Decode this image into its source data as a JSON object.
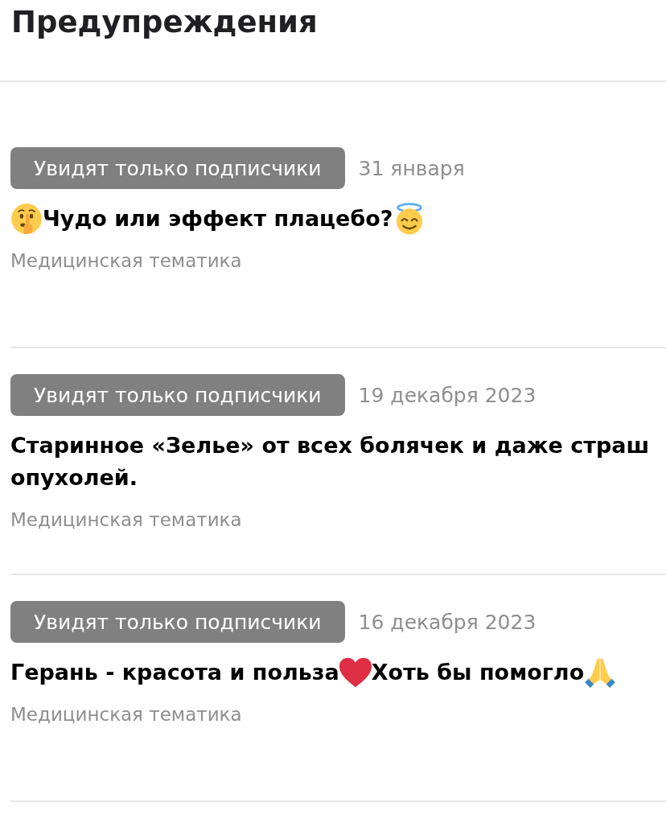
{
  "page": {
    "title": "Предупреждения"
  },
  "posts": [
    {
      "badge": "Увидят только подписчики",
      "date": "31 января",
      "title": [
        {
          "kind": "shush"
        },
        {
          "kind": "text",
          "text": "Чудо или эффект плацебо?"
        },
        {
          "kind": "halo"
        }
      ],
      "topic": "Медицинская тематика"
    },
    {
      "badge": "Увидят только подписчики",
      "date": "19 декабря 2023",
      "title": [
        {
          "kind": "text",
          "text": "Старинное «Зелье» от всех болячек и даже страш\nопухолей."
        }
      ],
      "topic": "Медицинская тематика"
    },
    {
      "badge": "Увидят только подписчики",
      "date": "16 декабря 2023",
      "title": [
        {
          "kind": "text",
          "text": "Герань - красота и польза"
        },
        {
          "kind": "heart"
        },
        {
          "kind": "text",
          "text": "Хоть бы помогло"
        },
        {
          "kind": "pray"
        }
      ],
      "topic": "Медицинская тематика"
    }
  ]
}
